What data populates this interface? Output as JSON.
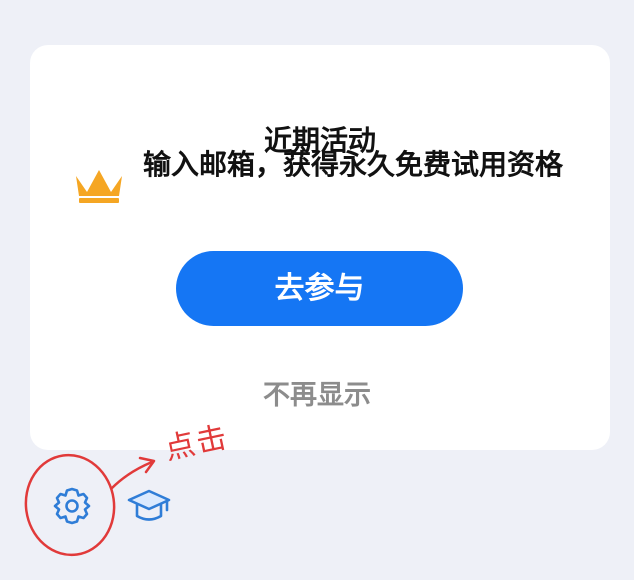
{
  "card": {
    "title": "近期活动",
    "promo_text": "输入邮箱，获得永久免费试用资格",
    "join_button": "去参与",
    "dismiss_link": "不再显示"
  },
  "annotation": {
    "text": "点击",
    "color": "#e13a3a"
  },
  "toolbar": {
    "icons": [
      "gear-icon",
      "graduation-cap-icon"
    ]
  },
  "colors": {
    "accent": "#1576f4",
    "crown": "#f5a623",
    "icon": "#2f7dd7"
  }
}
